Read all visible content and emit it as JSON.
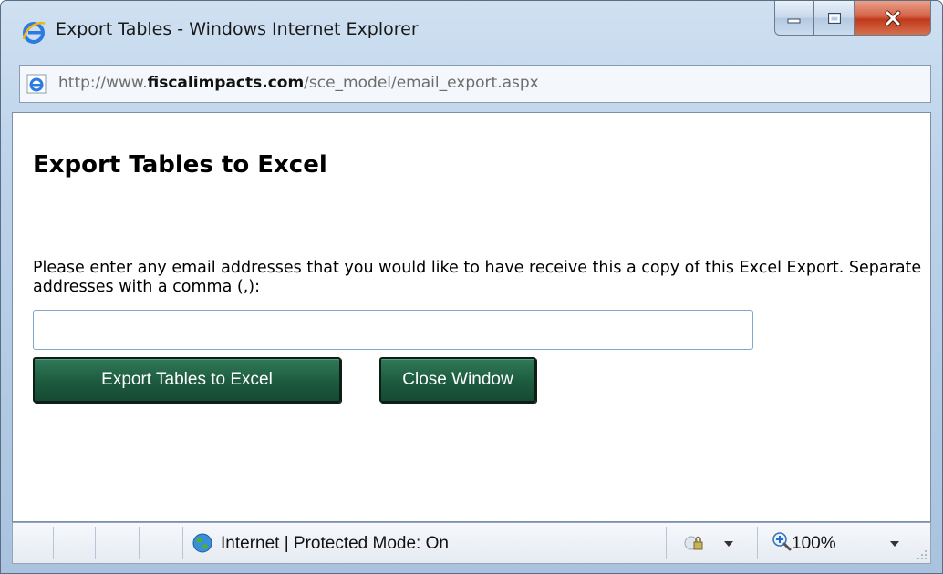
{
  "window": {
    "title": "Export Tables - Windows Internet Explorer",
    "icon": "ie-logo-icon"
  },
  "caption_buttons": {
    "minimize_icon": "minimize-icon",
    "maximize_icon": "maximize-icon",
    "close_icon": "close-icon",
    "close_color": "#c7391b"
  },
  "address": {
    "url_prefix": "http://www.",
    "url_domain": "fiscalimpacts.com",
    "url_path": "/sce_model/email_export.aspx"
  },
  "page": {
    "heading": "Export Tables to Excel",
    "instructions": "Please enter any email addresses that you would like to have receive this a copy of this Excel Export. Separate addresses with a comma (,):",
    "email_value": "",
    "export_button": "Export Tables to Excel",
    "close_button": "Close Window",
    "button_color": "#1f5d41"
  },
  "statusbar": {
    "zone_icon": "globe-icon",
    "zone_text": "Internet | Protected Mode: On",
    "security_icon": "security-icon",
    "zoom_icon": "zoom-icon",
    "zoom_text": "100%"
  }
}
